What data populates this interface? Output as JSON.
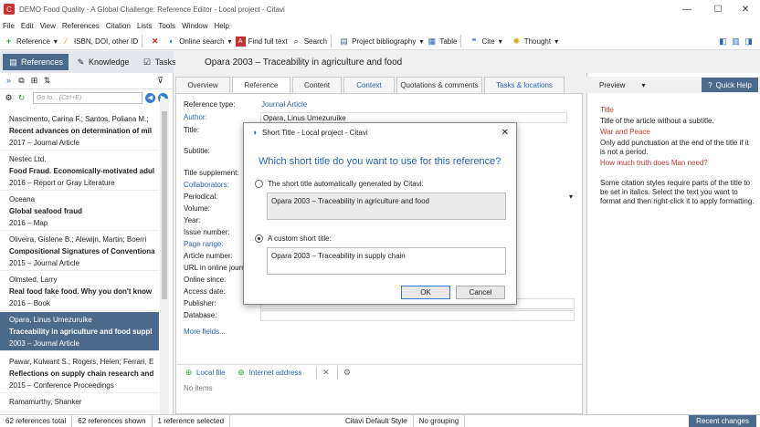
{
  "window": {
    "title": "DEMO Food Quality - A Global Challenge: Reference Editor - Local project - Citavi",
    "app_icon": "C"
  },
  "menu": [
    "File",
    "Edit",
    "View",
    "References",
    "Citation",
    "Lists",
    "Tools",
    "Window",
    "Help"
  ],
  "toolbar": {
    "reference": "Reference",
    "isbn": "ISBN, DOI, other ID",
    "online_search": "Online search",
    "find_full_text": "Find full text",
    "search": "Search",
    "project_bibliography": "Project bibliography",
    "table": "Table",
    "cite": "Cite",
    "thought": "Thought"
  },
  "nav": {
    "references": "References",
    "knowledge": "Knowledge",
    "tasks": "Tasks"
  },
  "ref_header": "Opara 2003 – Traceability in agriculture and food",
  "left": {
    "search_placeholder": "Go to... (Ctrl+E)",
    "items": [
      {
        "authors": "Nascimento, Carina F.; Santos, Poliana M.;",
        "title": "Recent advances on determination of mil",
        "meta": "2017 – Journal Article"
      },
      {
        "authors": "Nestec Ltd.",
        "title": "Food Fraud. Economically-motivated adul",
        "meta": "2016 – Report or Gray Literature"
      },
      {
        "authors": "Oceana",
        "title": "Global seafood fraud",
        "meta": "2016 – Map"
      },
      {
        "authors": "Oliveira, Gislene B.; Alewijn, Martin; Boerri",
        "title": "Compositional Signatures of Conventiona",
        "meta": "2015 – Journal Article"
      },
      {
        "authors": "Olmsted, Larry",
        "title": "Real food fake food. Why you don't know",
        "meta": "2016 – Book"
      },
      {
        "authors": "Opara, Linus Umezuruike",
        "title": "Traceability in agriculture and food suppl",
        "meta": "2003 – Journal Article"
      },
      {
        "authors": "Pawar, Kulwant S.; Rogers, Helen; Ferrari, E",
        "title": "Reflections on supply chain research and",
        "meta": "2015 – Conference Proceedings"
      },
      {
        "authors": "Ramamurthy, Shanker",
        "title": "",
        "meta": ""
      }
    ]
  },
  "tabs": {
    "overview": "Overview",
    "reference": "Reference",
    "content": "Content",
    "context": "Context",
    "quotations": "Quotations & comments",
    "tasks": "Tasks & locations"
  },
  "editor": {
    "reference_type_label": "Reference type:",
    "reference_type": "Journal Article",
    "author_label": "Author:",
    "author": "Opara, Linus Umezuruike",
    "title_label": "Title:",
    "subtitle_label": "Subtitle:",
    "title_supplement_label": "Title supplement:",
    "collaborators_label": "Collaborators:",
    "periodical_label": "Periodical:",
    "volume_label": "Volume:",
    "year_label": "Year:",
    "issue_label": "Issue number:",
    "page_range_label": "Page range:",
    "article_number_label": "Article number:",
    "url_label": "URL in online journ",
    "online_since_label": "Online since:",
    "access_date_label": "Access date:",
    "publisher_label": "Publisher:",
    "database_label": "Database:",
    "more_fields": "More fields...",
    "local_file": "Local file",
    "internet_address": "Internet address",
    "no_items": "No items"
  },
  "preview": {
    "label": "Preview",
    "quick_help": "Quick Help"
  },
  "help": {
    "h1": "Title",
    "p1": "Title of the article without a subtitle.",
    "e1": "War and Peace",
    "p2": "Only add punctuation at the end of the title if it is not a period.",
    "e2": "How much truth does Man need?",
    "p3": "Some citation styles require parts of the title to be set in italics. Select the text you want to format and then right-click it to apply formatting."
  },
  "dialog": {
    "title": "Short Title - Local project - Citavi",
    "question": "Which short title do you want to use for this reference?",
    "auto_label": "The short title automatically generated by Citavi:",
    "auto_value": "Opara 2003 – Traceability in agriculture and food",
    "custom_label": "A custom short title:",
    "custom_value": "Opara 2003 – Traceability in supply chain",
    "ok": "OK",
    "cancel": "Cancel"
  },
  "status": {
    "total": "62 references total",
    "shown": "62 references shown",
    "selected": "1 reference selected",
    "style": "Citavi Default Style",
    "grouping": "No grouping",
    "recent": "Recent changes"
  },
  "colors": {
    "accent": "#4c6a8c",
    "link": "#2a63b0",
    "help_red": "#c0392b"
  }
}
